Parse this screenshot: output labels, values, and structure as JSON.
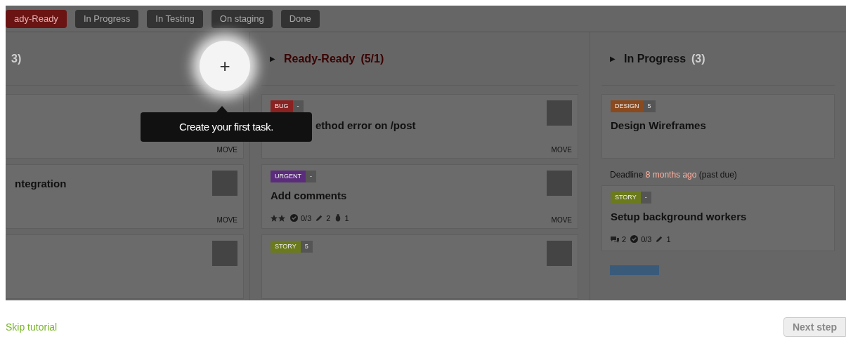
{
  "tabs": [
    {
      "label": "ady-Ready",
      "selected": true
    },
    {
      "label": "In Progress",
      "selected": false
    },
    {
      "label": "In Testing",
      "selected": false
    },
    {
      "label": "On staging",
      "selected": false
    },
    {
      "label": "Done",
      "selected": false
    }
  ],
  "add_button": {
    "label": "+"
  },
  "tooltip": "Create your first task.",
  "columns": [
    {
      "header": {
        "count": "3)",
        "highlighted": false
      },
      "items": [
        {
          "kind": "card",
          "move": "MOVE",
          "avatar": false
        },
        {
          "kind": "card",
          "title": "ntegration",
          "move": "MOVE",
          "avatar": true
        },
        {
          "kind": "card",
          "avatar": true
        }
      ]
    },
    {
      "header": {
        "expander": "▶",
        "title": "Ready-Ready",
        "count": "(5/1)",
        "highlighted": true
      },
      "items": [
        {
          "kind": "card",
          "tag": {
            "label": "BUG",
            "color": "#8a2222"
          },
          "points": "-",
          "title": "ethod error on /post",
          "move": "MOVE",
          "avatar": true
        },
        {
          "kind": "card",
          "tag": {
            "label": "URGENT",
            "color": "#5b2c7c"
          },
          "points": "-",
          "title": "Add comments",
          "move": "MOVE",
          "avatar": true,
          "stats": [
            {
              "kind": "stars"
            },
            {
              "kind": "check",
              "text": "0/3"
            },
            {
              "kind": "pencil",
              "text": "2"
            },
            {
              "kind": "bug",
              "text": "1"
            }
          ]
        },
        {
          "kind": "card",
          "tag": {
            "label": "STORY",
            "color": "#6b7a1c"
          },
          "points": "5",
          "avatar": true
        }
      ]
    },
    {
      "header": {
        "expander": "▶",
        "title": "In Progress",
        "count": "(3)",
        "highlighted": false
      },
      "items": [
        {
          "kind": "card",
          "tag": {
            "label": "DESIGN",
            "color": "#8a4a1e"
          },
          "points": "5",
          "title": "Design Wireframes",
          "avatar": false
        },
        {
          "kind": "deadline",
          "label": "Deadline",
          "when": "8 months ago",
          "note": "(past due)"
        },
        {
          "kind": "card",
          "tag": {
            "label": "STORY",
            "color": "#6b7a1c"
          },
          "points": "-",
          "title": "Setup background workers",
          "avatar": false,
          "stats": [
            {
              "kind": "comments",
              "text": "2"
            },
            {
              "kind": "check",
              "text": "0/3"
            },
            {
              "kind": "pencil",
              "text": "1"
            }
          ]
        },
        {
          "kind": "tagonly",
          "tag": {
            "color": "#3a5a7a"
          }
        }
      ]
    }
  ],
  "skip_link": "Skip tutorial",
  "next_button": "Next step"
}
